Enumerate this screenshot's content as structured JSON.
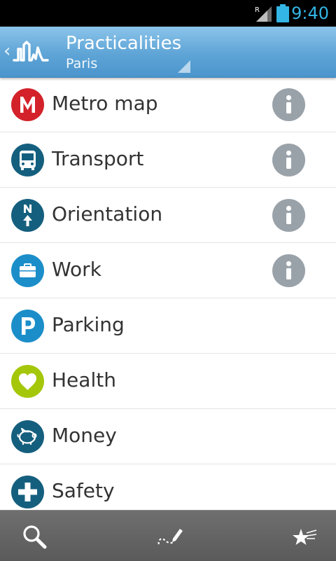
{
  "status_bar": {
    "time": "9:40",
    "roaming_indicator": "R",
    "accent_color": "#33b5e5",
    "icons": [
      "signal-icon",
      "battery-icon"
    ]
  },
  "action_bar": {
    "up_icon": "chevron-left-icon",
    "logo_icon": "city-skyline-logo",
    "title": "Practicalities",
    "subtitle": "Paris",
    "background_color": "#5ea4d6"
  },
  "list": {
    "items": [
      {
        "label": "Metro map",
        "icon": "metro-icon",
        "icon_color": "#d3222a",
        "has_info": true
      },
      {
        "label": "Transport",
        "icon": "bus-icon",
        "icon_color": "#155f7e",
        "has_info": true
      },
      {
        "label": "Orientation",
        "icon": "north-arrow-icon",
        "icon_color": "#155f7e",
        "has_info": true
      },
      {
        "label": "Work",
        "icon": "briefcase-icon",
        "icon_color": "#1b8ec9",
        "has_info": true
      },
      {
        "label": "Parking",
        "icon": "parking-icon",
        "icon_color": "#1b8ec9",
        "has_info": false
      },
      {
        "label": "Health",
        "icon": "heart-icon",
        "icon_color": "#a4c70a",
        "has_info": false
      },
      {
        "label": "Money",
        "icon": "piggy-bank-icon",
        "icon_color": "#155f7e",
        "has_info": false
      },
      {
        "label": "Safety",
        "icon": "cross-icon",
        "icon_color": "#155f7e",
        "has_info": false
      }
    ],
    "info_icon": "info-icon",
    "info_color": "#9aa2a9"
  },
  "bottom_bar": {
    "buttons": [
      "search-icon",
      "route-pencil-icon",
      "favorites-stars-icon"
    ]
  }
}
